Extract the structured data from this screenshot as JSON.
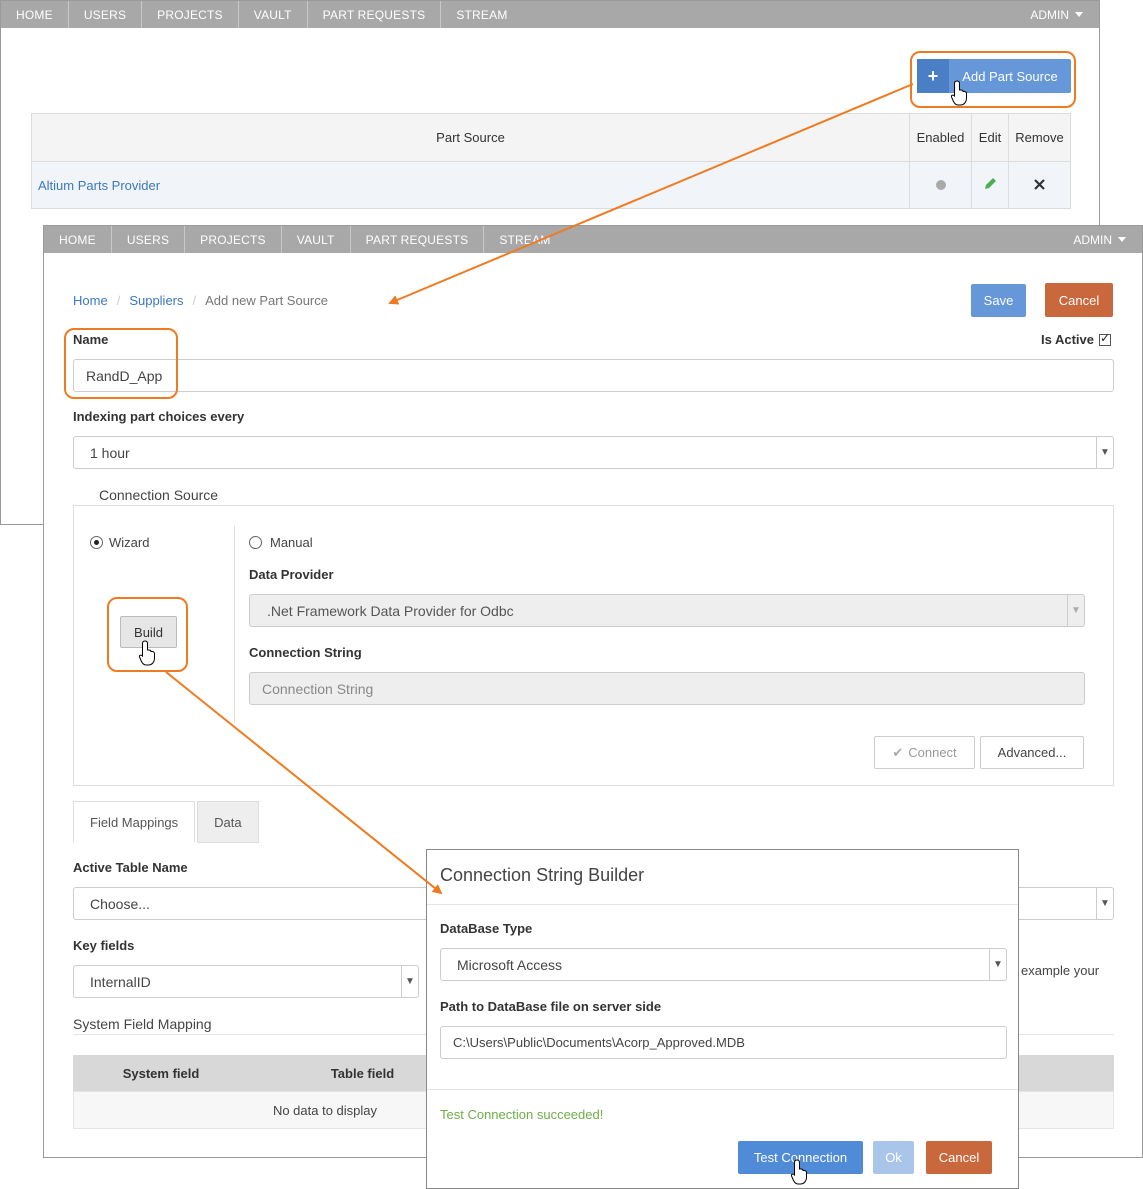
{
  "nav_items": [
    "HOME",
    "USERS",
    "PROJECTS",
    "VAULT",
    "PART REQUESTS",
    "STREAM"
  ],
  "admin_label": "ADMIN",
  "back": {
    "add_button": "Add Part Source",
    "table": {
      "col_part_source": "Part Source",
      "col_enabled": "Enabled",
      "col_edit": "Edit",
      "col_remove": "Remove",
      "row_name": "Altium Parts Provider"
    }
  },
  "front": {
    "breadcrumb": [
      "Home",
      "Suppliers",
      "Add new Part Source"
    ],
    "save": "Save",
    "cancel": "Cancel",
    "name_label": "Name",
    "is_active_label": "Is Active",
    "name_value": "RandD_App",
    "indexing_label": "Indexing part choices every",
    "indexing_value": "1 hour",
    "connection_source_legend": "Connection Source",
    "wizard_label": "Wizard",
    "manual_label": "Manual",
    "build_button": "Build",
    "data_provider_label": "Data Provider",
    "data_provider_value": ".Net Framework Data Provider for Odbc",
    "connection_string_label": "Connection String",
    "connection_string_placeholder": "Connection String",
    "connect_button": "Connect",
    "advanced_button": "Advanced...",
    "tab_field_mappings": "Field Mappings",
    "tab_data": "Data",
    "active_table_label": "Active Table Name",
    "active_table_value": "Choose...",
    "key_fields_label": "Key fields",
    "key_fields_value": "InternalID",
    "key_fields_hint": "example your",
    "system_field_mapping": "System Field Mapping",
    "grid_col_system": "System field",
    "grid_col_table": "Table field",
    "grid_empty": "No data to display"
  },
  "modal": {
    "title": "Connection String Builder",
    "db_type_label": "DataBase Type",
    "db_type_value": "Microsoft Access",
    "path_label": "Path to DataBase file on server side",
    "path_value": "C:\\Users\\Public\\Documents\\Acorp_Approved.MDB",
    "status": "Test Connection succeeded!",
    "test_button": "Test Connection",
    "ok_button": "Ok",
    "cancel_button": "Cancel"
  },
  "colors": {
    "highlight": "#ef7a22",
    "primary": "#6597d9",
    "danger": "#c9673d",
    "success": "#6fae4a",
    "nav": "#a8a8a8"
  }
}
